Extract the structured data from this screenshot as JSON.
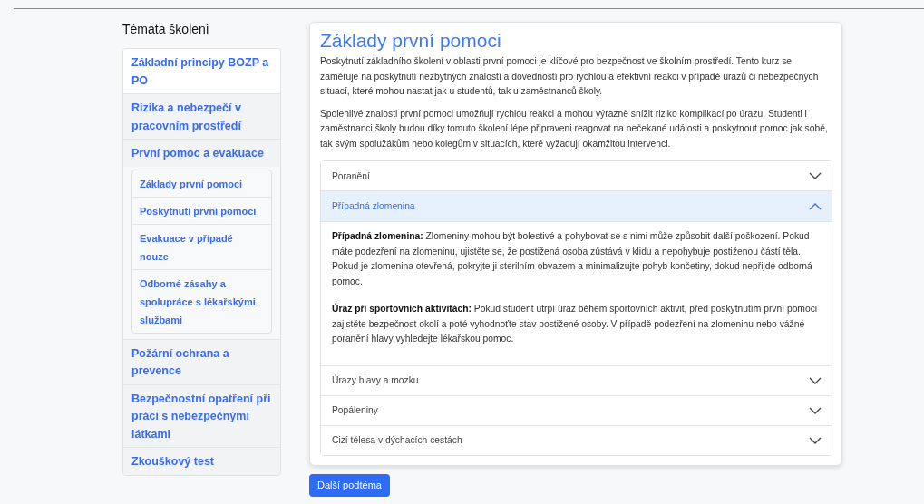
{
  "sidebar": {
    "title": "Témata školení",
    "items": [
      {
        "label": "Základní principy BOZP a PO",
        "highlighted": true
      },
      {
        "label": "Rizika a nebezpečí v pracovním prostředí",
        "highlighted": false
      },
      {
        "label": "První pomoc a evakuace",
        "highlighted": false,
        "children": [
          {
            "label": "Základy první pomoci"
          },
          {
            "label": "Poskytnutí první pomoci"
          },
          {
            "label": "Evakuace v případě nouze"
          },
          {
            "label": "Odborné zásahy a spolupráce s lékařskými službami"
          }
        ]
      },
      {
        "label": "Požární ochrana a prevence",
        "highlighted": false
      },
      {
        "label": "Bezpečnostní opatření při práci s nebezpečnými látkami",
        "highlighted": false
      },
      {
        "label": "Zkouškový test",
        "highlighted": false
      }
    ]
  },
  "article": {
    "title": "Základy první pomoci",
    "paragraphs": [
      "Poskytnutí základního školení v oblasti první pomoci je klíčové pro bezpečnost ve školním prostředí. Tento kurz se zaměřuje na poskytnutí nezbytných znalostí a dovedností pro rychlou a efektivní reakci v případě úrazů či nebezpečných situací, které mohou nastat jak u studentů, tak u zaměstnanců školy.",
      "Spolehlivé znalosti první pomoci umožňují rychlou reakci a mohou výrazně snížit riziko komplikací po úrazu. Studenti i zaměstnanci školy budou díky tomuto školení lépe připraveni reagovat na nečekané události a poskytnout pomoc jak sobě, tak svým spolužákům nebo kolegům v situacích, které vyžadují okamžitou intervenci."
    ],
    "accordion": [
      {
        "title": "Poranění",
        "expanded": false
      },
      {
        "title": "Případná zlomenina",
        "expanded": true,
        "body": [
          "**Případná zlomenina:** Zlomeniny mohou být bolestivé a pohybovat se s nimi může způsobit další poškození. Pokud máte podezření na zlomeninu, ujistěte se, že postižená osoba zůstává v klidu a nepohybuje postiženou částí těla. Pokud je zlomenina otevřená, pokryjte ji sterilním obvazem a minimalizujte pohyb končetiny, dokud nepřijde odborná pomoc.",
          "**Úraz při sportovních aktivitách:** Pokud student utrpí úraz během sportovních aktivit, před poskytnutím první pomoci zajistěte bezpečnost okolí a poté vyhodnoťte stav postižené osoby. V případě podezření na zlomeninu nebo vážné poranění hlavy vyhledejte lékařskou pomoc."
        ]
      },
      {
        "title": "Úrazy hlavy a mozku",
        "expanded": false
      },
      {
        "title": "Popáleniny",
        "expanded": false
      },
      {
        "title": "Cizí tělesa v dýchacích cestách",
        "expanded": false
      }
    ]
  },
  "next_button": "Další podtéma"
}
